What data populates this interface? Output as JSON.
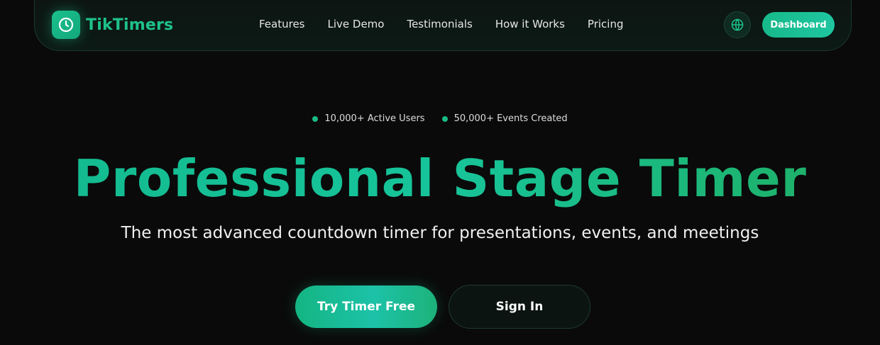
{
  "brand": {
    "name": "TikTimers",
    "logo_icon": "clock-icon",
    "color": "#1ec28b"
  },
  "nav": {
    "links": [
      "Features",
      "Live Demo",
      "Testimonials",
      "How it Works",
      "Pricing"
    ],
    "language_icon": "globe-icon",
    "dashboard_label": "Dashboard"
  },
  "stats": [
    {
      "label": "10,000+ Active Users"
    },
    {
      "label": "50,000+ Events Created"
    }
  ],
  "hero": {
    "title": "Professional Stage Timer",
    "subtitle": "The most advanced countdown timer for presentations, events, and meetings"
  },
  "cta": {
    "primary_label": "Try Timer Free",
    "secondary_label": "Sign In"
  },
  "colors": {
    "accent": "#1bbf8c",
    "background": "#0a0a0a"
  }
}
